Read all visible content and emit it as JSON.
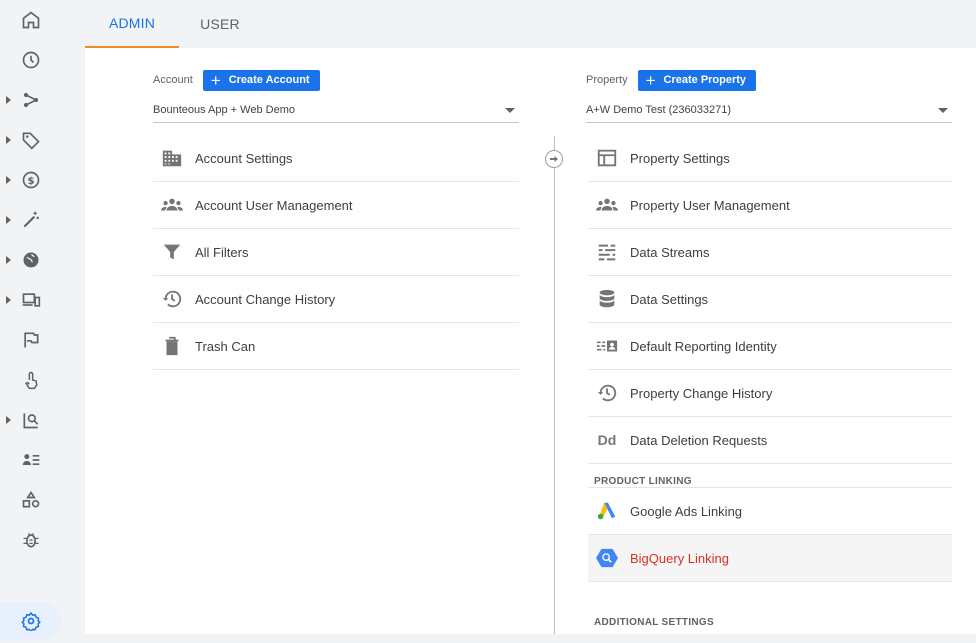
{
  "tabs": {
    "admin": "ADMIN",
    "user": "USER"
  },
  "account": {
    "label": "Account",
    "create_button": "Create Account",
    "selected": "Bounteous App + Web Demo",
    "items": [
      {
        "label": "Account Settings",
        "icon": "building-icon"
      },
      {
        "label": "Account User Management",
        "icon": "people-icon"
      },
      {
        "label": "All Filters",
        "icon": "filter-icon"
      },
      {
        "label": "Account Change History",
        "icon": "history-icon"
      },
      {
        "label": "Trash Can",
        "icon": "trash-icon"
      }
    ]
  },
  "property": {
    "label": "Property",
    "create_button": "Create Property",
    "selected": "A+W Demo Test (236033271)",
    "items": [
      {
        "label": "Property Settings",
        "icon": "property-settings-icon"
      },
      {
        "label": "Property User Management",
        "icon": "people-icon"
      },
      {
        "label": "Data Streams",
        "icon": "streams-icon"
      },
      {
        "label": "Data Settings",
        "icon": "database-icon"
      },
      {
        "label": "Default Reporting Identity",
        "icon": "identity-icon"
      },
      {
        "label": "Property Change History",
        "icon": "history-icon"
      },
      {
        "label": "Data Deletion Requests",
        "icon": "dd-icon"
      }
    ],
    "product_linking": {
      "heading": "PRODUCT LINKING",
      "items": [
        {
          "label": "Google Ads Linking",
          "icon": "google-ads-icon"
        },
        {
          "label": "BigQuery Linking",
          "icon": "bigquery-icon",
          "selected": true
        }
      ]
    },
    "additional_heading": "ADDITIONAL SETTINGS",
    "dd_glyph": "Dd"
  },
  "rail": {
    "icons": [
      "home-icon",
      "clock-icon",
      "flow-icon",
      "tag-icon",
      "dollar-icon",
      "magic-wand-icon",
      "globe-icon",
      "devices-icon",
      "flag-icon",
      "touch-icon",
      "report-search-icon",
      "audience-icon",
      "shapes-icon",
      "debug-icon",
      "admin-gear-icon"
    ]
  },
  "colors": {
    "accent": "#1a73e8",
    "tab_underline": "#f28b26",
    "selected_text": "#d93025"
  }
}
